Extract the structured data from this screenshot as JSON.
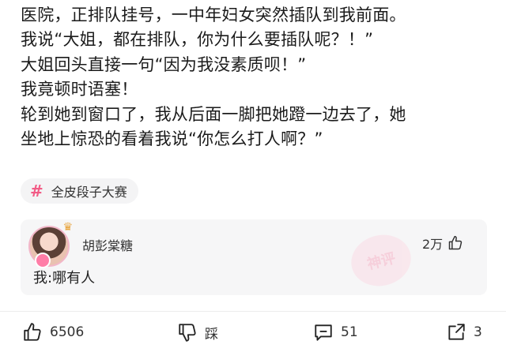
{
  "post": {
    "lines": [
      "医院，正排队挂号，一中年妇女突然插队到我前面。",
      "我说“大姐，都在排队，你为什么要插队呢？！”",
      "大姐回头直接一句“因为我没素质呗！”",
      "我竟顿时语塞！",
      "轮到她到窗口了，我从后面一脚把她蹬一边去了，她",
      "坐地上惊恐的看着我说“你怎么打人啊？”"
    ]
  },
  "tag": {
    "symbol": "#",
    "label": "全皮段子大赛"
  },
  "comment": {
    "username": "胡彭棠糖",
    "text": "我:哪有人",
    "like_count": "2万",
    "watermark": "神评"
  },
  "actions": {
    "like_count": "6506",
    "dislike_label": "踩",
    "comment_count": "51",
    "share_count": "3"
  },
  "colors": {
    "accent": "#f25c86",
    "comment_bg": "#f6f6f7",
    "tag_bg": "#f4f4f5"
  }
}
